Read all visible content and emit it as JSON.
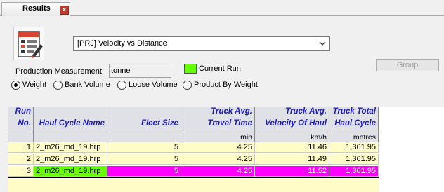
{
  "tab": {
    "label": "Results",
    "close": "×"
  },
  "report_selector": {
    "value": "[PRJ] Velocity vs Distance"
  },
  "group_button": "Group",
  "production_measurement": {
    "label": "Production Measurement",
    "value": "tonne"
  },
  "current_run": {
    "label": "Current Run",
    "color": "#66ff00"
  },
  "radio_options": [
    {
      "label": "Weight",
      "selected": true
    },
    {
      "label": "Bank Volume",
      "selected": false
    },
    {
      "label": "Loose Volume",
      "selected": false
    },
    {
      "label": "Product By Weight",
      "selected": false
    }
  ],
  "table": {
    "headers": [
      {
        "line1": "Run",
        "line2": "No.",
        "unit": ""
      },
      {
        "line1": "",
        "line2": "Haul Cycle Name",
        "unit": ""
      },
      {
        "line1": "",
        "line2": "Fleet Size",
        "unit": ""
      },
      {
        "line1": "Truck Avg.",
        "line2": "Travel Time",
        "unit": "min"
      },
      {
        "line1": "Truck Avg.",
        "line2": "Velocity Of Haul",
        "unit": "km/h"
      },
      {
        "line1": "Truck Total",
        "line2": "Haul Cycle",
        "unit": "metres"
      }
    ],
    "rows": [
      {
        "run": "1",
        "name": "2_m26_md_19.hrp",
        "fleet": "5",
        "time": "4.25",
        "velocity": "11.46",
        "distance": "1,361.95",
        "highlight": false
      },
      {
        "run": "2",
        "name": "2_m26_md_19.hrp",
        "fleet": "5",
        "time": "4.25",
        "velocity": "11.49",
        "distance": "1,361.95",
        "highlight": false
      },
      {
        "run": "3",
        "name": "2_m26_md_19.hrp",
        "fleet": "5",
        "time": "4.25",
        "velocity": "11.52",
        "distance": "1,361.95",
        "highlight": true
      }
    ],
    "colors": {
      "row_bg": "#fffcc8",
      "highlight_bg": "#ff00ff",
      "current_name_bg": "#66ff00",
      "header_text": "#1b1bcc"
    }
  }
}
